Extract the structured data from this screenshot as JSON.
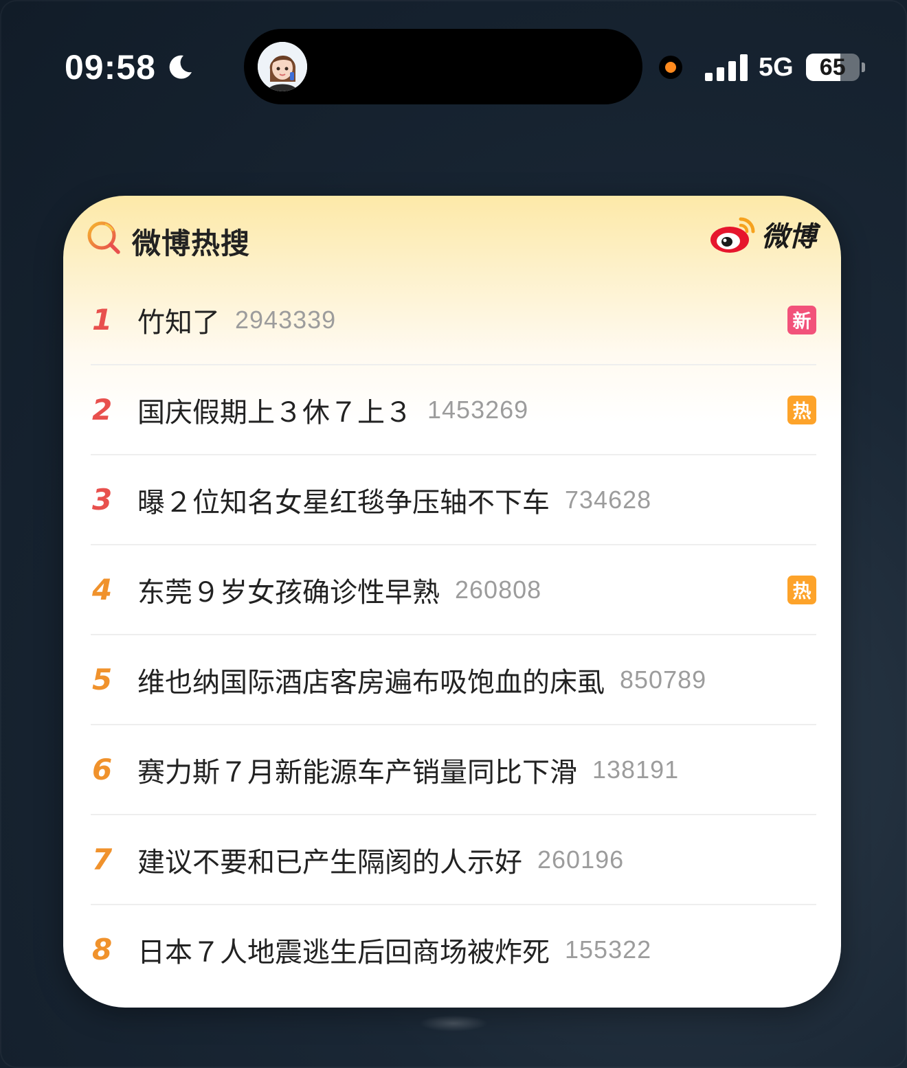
{
  "status_bar": {
    "time": "09:58",
    "network": "5G",
    "battery": "65",
    "battery_level": 0.65,
    "signal_bars": 4,
    "privacy_dot_color": "#ff8a1e",
    "icons": [
      "moon-icon",
      "signal-icon",
      "battery-icon"
    ]
  },
  "widget": {
    "title": "微博热搜",
    "brand": "微博",
    "colors": {
      "rank_top": "#e8504d",
      "rank_rest": "#f0922c",
      "badge_new": "#f2527a",
      "badge_hot": "#fda32a"
    },
    "items": [
      {
        "rank": "1",
        "title": "竹知了",
        "count": "2943339",
        "badge": "新",
        "badge_type": "new"
      },
      {
        "rank": "2",
        "title": "国庆假期上３休７上３",
        "count": "1453269",
        "badge": "热",
        "badge_type": "hot"
      },
      {
        "rank": "3",
        "title": "曝２位知名女星红毯争压轴不下车",
        "count": "734628",
        "badge": "",
        "badge_type": ""
      },
      {
        "rank": "4",
        "title": "东莞９岁女孩确诊性早熟",
        "count": "260808",
        "badge": "热",
        "badge_type": "hot"
      },
      {
        "rank": "5",
        "title": "维也纳国际酒店客房遍布吸饱血的床虱",
        "count": "850789",
        "badge": "",
        "badge_type": ""
      },
      {
        "rank": "6",
        "title": "赛力斯７月新能源车产销量同比下滑",
        "count": "138191",
        "badge": "",
        "badge_type": ""
      },
      {
        "rank": "7",
        "title": "建议不要和已产生隔阂的人示好",
        "count": "260196",
        "badge": "",
        "badge_type": ""
      },
      {
        "rank": "8",
        "title": "日本７人地震逃生后回商场被炸死",
        "count": "155322",
        "badge": "",
        "badge_type": ""
      }
    ]
  }
}
